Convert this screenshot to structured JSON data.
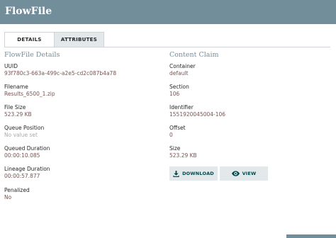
{
  "window": {
    "title": "FlowFile"
  },
  "tabs": [
    {
      "label": "DETAILS",
      "active": true
    },
    {
      "label": "ATTRIBUTES",
      "active": false
    }
  ],
  "details": {
    "title": "FlowFile Details",
    "uuid": {
      "label": "UUID",
      "value": "93f780c3-663a-499c-a2e5-cd2c087b4a78"
    },
    "filename": {
      "label": "Filename",
      "value": "Results_6500_1.zip"
    },
    "file_size": {
      "label": "File Size",
      "value": "523.29 KB"
    },
    "queue_position": {
      "label": "Queue Position",
      "value": "No value set"
    },
    "queued_duration": {
      "label": "Queued Duration",
      "value": "00:00:10.085"
    },
    "lineage_duration": {
      "label": "Lineage Duration",
      "value": "00:00:57.877"
    },
    "penalized": {
      "label": "Penalized",
      "value": "No"
    }
  },
  "content_claim": {
    "title": "Content Claim",
    "container": {
      "label": "Container",
      "value": "default"
    },
    "section": {
      "label": "Section",
      "value": "106"
    },
    "identifier": {
      "label": "Identifier",
      "value": "1551920045004-106"
    },
    "offset": {
      "label": "Offset",
      "value": "0"
    },
    "size": {
      "label": "Size",
      "value": "523.29 KB"
    },
    "download_label": "DOWNLOAD",
    "view_label": "VIEW"
  },
  "icons": {
    "download": "download-icon",
    "view": "eye-icon"
  },
  "colors": {
    "header": "#728e9b",
    "value_text": "#775351",
    "button_bg": "#e3e8eb",
    "button_text": "#004849"
  }
}
